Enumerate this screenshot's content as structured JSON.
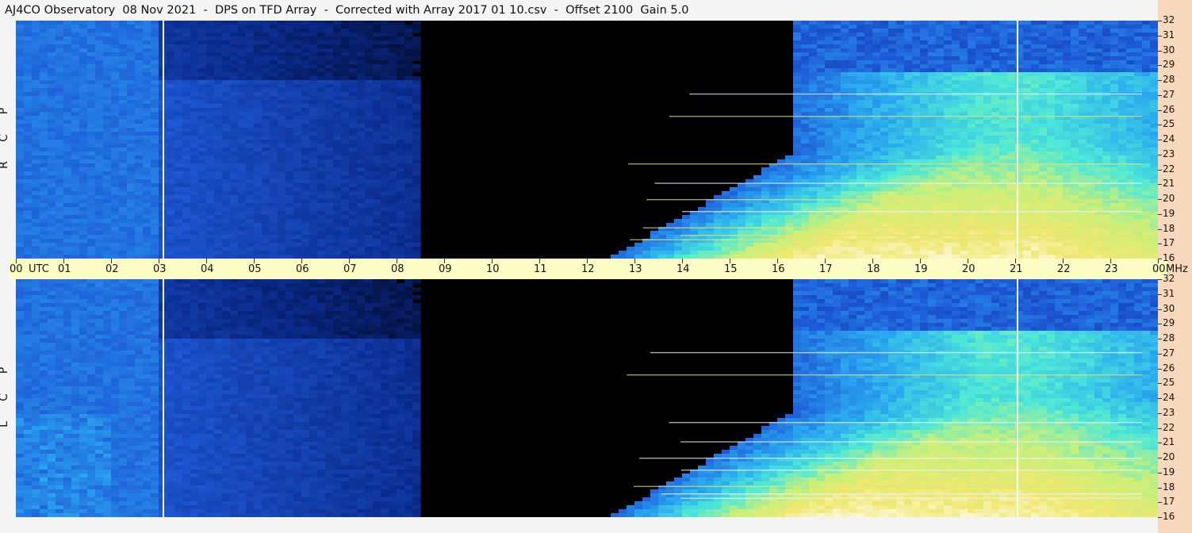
{
  "title": "AJ4CO Observatory  08 Nov 2021  -  DPS on TFD Array  -  Corrected with Array 2017 01 10.csv  -  Offset 2100  Gain 5.0",
  "panels": {
    "rcp": {
      "label_letters": [
        "R",
        "C",
        "P"
      ]
    },
    "lcp": {
      "label_letters": [
        "L",
        "C",
        "P"
      ]
    }
  },
  "chart_data": {
    "type": "heatmap",
    "title": "AJ4CO Observatory  08 Nov 2021  -  DPS on TFD Array  -  Corrected with Array 2017 01 10.csv  -  Offset 2100  Gain 5.0",
    "x_unit": "UTC",
    "y_unit": "MHz",
    "x_ticks": [
      "00",
      "01",
      "02",
      "03",
      "04",
      "05",
      "06",
      "07",
      "08",
      "09",
      "10",
      "11",
      "12",
      "13",
      "14",
      "15",
      "16",
      "17",
      "18",
      "19",
      "20",
      "21",
      "22",
      "23",
      "00"
    ],
    "x_range_hours": [
      0,
      24
    ],
    "y_ticks": [
      16,
      17,
      18,
      19,
      20,
      21,
      22,
      23,
      24,
      25,
      26,
      27,
      28,
      29,
      30,
      31,
      32
    ],
    "y_range_mhz": [
      16,
      32
    ],
    "panels": [
      "RCP",
      "LCP"
    ],
    "white_vertical_markers_utc": [
      3.1,
      21.05
    ],
    "colormap": [
      "#000008",
      "#0a2a8a",
      "#1e5ad8",
      "#2aa8f0",
      "#4ce8d8",
      "#c8f07a",
      "#f0e870",
      "#ffffff"
    ]
  }
}
